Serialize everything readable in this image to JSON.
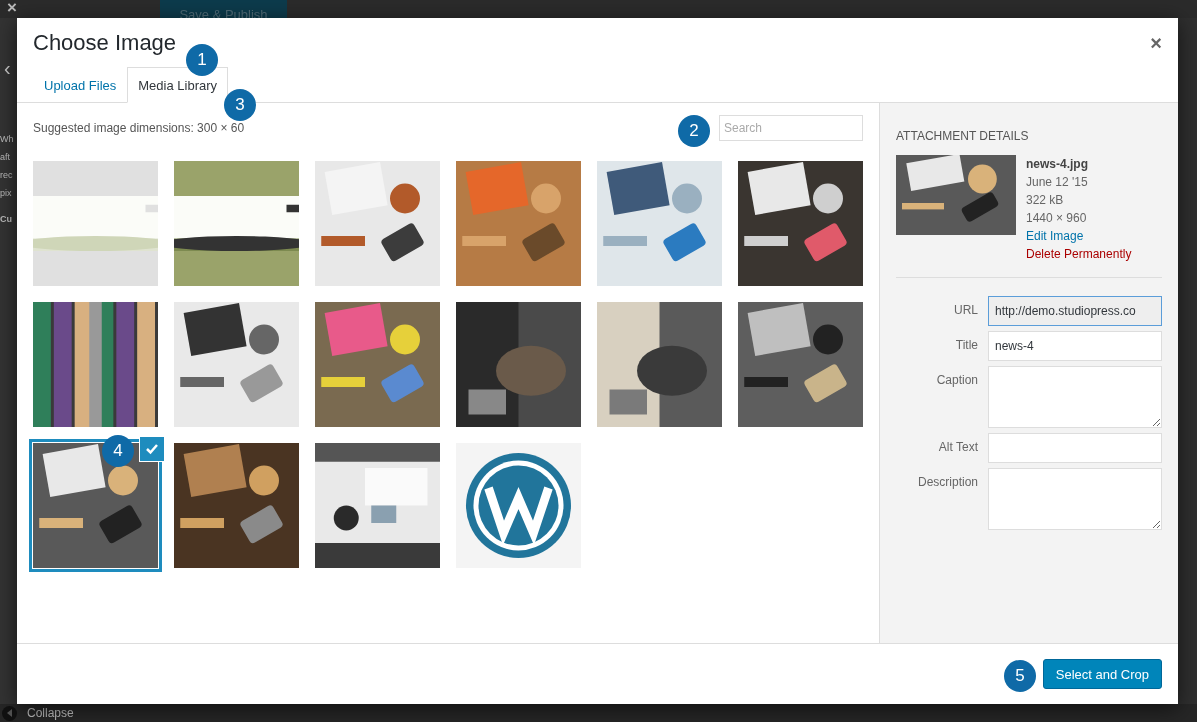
{
  "background": {
    "close": "×",
    "publish_button": "Save & Publish",
    "back": "‹",
    "fragments": [
      "Wh",
      "aft",
      "rec",
      "pix",
      "Cu"
    ],
    "collapse": "Collapse"
  },
  "modal": {
    "title": "Choose Image",
    "close": "×",
    "tabs": [
      {
        "label": "Upload Files",
        "selected": false
      },
      {
        "label": "Media Library",
        "selected": true
      }
    ],
    "hint": "Suggested image dimensions: 300 × 60",
    "search": {
      "placeholder": "Search"
    },
    "images": [
      {
        "kind": "picture",
        "selected": false
      },
      {
        "kind": "picture",
        "selected": false
      },
      {
        "kind": "picture",
        "selected": false
      },
      {
        "kind": "picture",
        "selected": false
      },
      {
        "kind": "picture",
        "selected": false
      },
      {
        "kind": "picture",
        "selected": false
      },
      {
        "kind": "picture",
        "selected": false
      },
      {
        "kind": "picture",
        "selected": false
      },
      {
        "kind": "picture",
        "selected": false
      },
      {
        "kind": "picture",
        "selected": false
      },
      {
        "kind": "picture",
        "selected": false
      },
      {
        "kind": "picture",
        "selected": false
      },
      {
        "kind": "picture",
        "selected": true
      },
      {
        "kind": "picture",
        "selected": false
      },
      {
        "kind": "picture",
        "selected": false
      },
      {
        "kind": "picture",
        "selected": false
      }
    ],
    "details": {
      "heading": "ATTACHMENT DETAILS",
      "filename": "news-4.jpg",
      "date": "June 12 '15",
      "size": "322 kB",
      "dimensions": "1440 × 960",
      "edit_link": "Edit Image",
      "delete_link": "Delete Permanently",
      "fields": [
        {
          "label": "URL",
          "kind": "readonly",
          "value": "http://demo.studiopress.co"
        },
        {
          "label": "Title",
          "kind": "text",
          "value": "news-4"
        },
        {
          "label": "Caption",
          "kind": "textarea"
        },
        {
          "label": "Alt Text",
          "kind": "text"
        },
        {
          "label": "Description",
          "kind": "textarea"
        }
      ]
    },
    "footer": {
      "button": "Select and Crop"
    }
  },
  "callouts": [
    "1",
    "2",
    "3",
    "4",
    "5"
  ]
}
